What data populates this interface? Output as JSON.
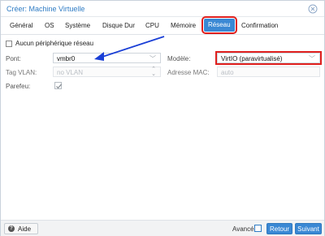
{
  "window": {
    "title": "Créer: Machine Virtuelle",
    "close_icon": "close-circle-icon"
  },
  "tabs": [
    {
      "label": "Général",
      "active": false
    },
    {
      "label": "OS",
      "active": false
    },
    {
      "label": "Système",
      "active": false
    },
    {
      "label": "Disque Dur",
      "active": false
    },
    {
      "label": "CPU",
      "active": false
    },
    {
      "label": "Mémoire",
      "active": false
    },
    {
      "label": "Réseau",
      "active": true
    },
    {
      "label": "Confirmation",
      "active": false
    }
  ],
  "form": {
    "no_network_label": "Aucun périphérique réseau",
    "no_network_checked": false,
    "bridge_label": "Pont:",
    "bridge_value": "vmbr0",
    "vlan_label": "Tag VLAN:",
    "vlan_placeholder": "no VLAN",
    "firewall_label": "Parefeu:",
    "firewall_checked": true,
    "model_label": "Modèle:",
    "model_value": "VirtIO (paravirtualisé)",
    "mac_label": "Adresse MAC:",
    "mac_placeholder": "auto"
  },
  "footer": {
    "help_label": "Aide",
    "advanced_label": "Avancé",
    "advanced_checked": false,
    "back_label": "Retour",
    "next_label": "Suivant"
  },
  "colors": {
    "accent": "#3a88d4",
    "title": "#2e7bc4",
    "highlight": "#e0201e",
    "annotation_arrow": "#1a3fd6"
  }
}
